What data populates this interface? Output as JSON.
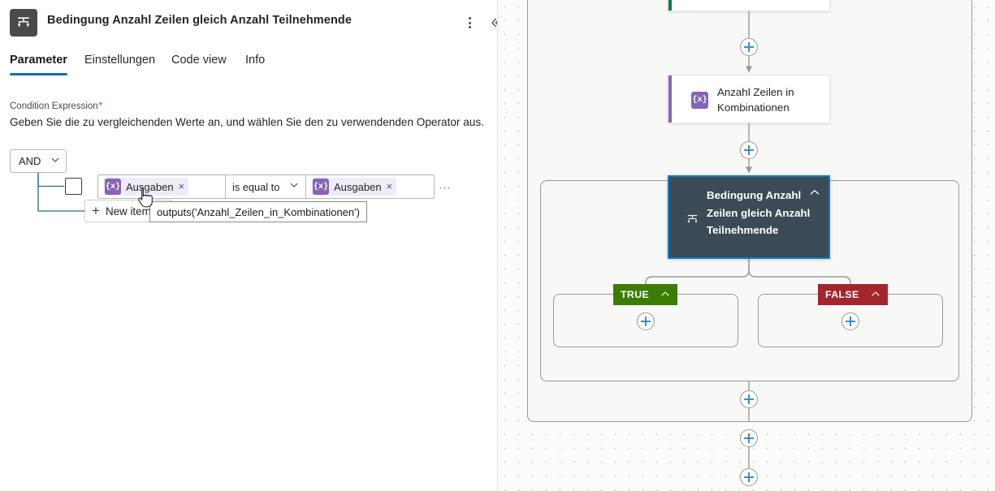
{
  "panel": {
    "icon_name": "condition-icon",
    "title": "Bedingung Anzahl Zeilen gleich Anzahl Teilnehmende",
    "more_label": "⋮",
    "collapse_label": "«",
    "tabs": [
      {
        "label": "Parameter",
        "active": true
      },
      {
        "label": "Einstellungen",
        "active": false
      },
      {
        "label": "Code view",
        "active": false
      },
      {
        "label": "Info",
        "active": false
      }
    ],
    "condition": {
      "field_label": "Condition Expression",
      "required_mark": "*",
      "description": "Geben Sie die zu vergleichenden Werte an, und wählen Sie den zu verwendenden Operator aus.",
      "logic_operator": "AND",
      "rows": [
        {
          "left_token": {
            "label": "Ausgaben",
            "icon": "expression-icon",
            "remove": "×"
          },
          "operator": "is equal to",
          "right_token": {
            "label": "Ausgaben",
            "icon": "expression-icon",
            "remove": "×"
          },
          "overflow": "⋯"
        }
      ],
      "new_item_label": "New item",
      "new_item_plus": "+",
      "tooltip": "outputs('Anzahl_Zeilen_in_Kombinationen')"
    }
  },
  "canvas": {
    "nodes": [
      {
        "id": "top",
        "title": "",
        "accent": "#107c41",
        "icon": "link-icon"
      },
      {
        "id": "compose",
        "title": "Anzahl Zeilen in Kombinationen",
        "accent": "#8764b8",
        "icon": "expression-icon"
      },
      {
        "id": "condition",
        "title": "Bedingung Anzahl Zeilen gleich Anzahl Teilnehmende",
        "accent": "#0f7ac0",
        "icon": "condition-icon",
        "selected": true,
        "caret": "chevron-up-icon"
      }
    ],
    "branches": [
      {
        "label": "TRUE",
        "color": "#3a7d00",
        "caret": "chevron-up-icon"
      },
      {
        "label": "FALSE",
        "color": "#a4262c",
        "caret": "chevron-up-icon"
      }
    ],
    "add_buttons": 6
  },
  "colors": {
    "accent_blue": "#0f6cbd",
    "plus_blue": "#3b8cd0",
    "purple": "#8764b8",
    "green": "#107c41",
    "true_green": "#3a7d00",
    "false_red": "#a4262c",
    "selected_node_bg": "#3b4a54",
    "required_red": "#c4314b"
  }
}
